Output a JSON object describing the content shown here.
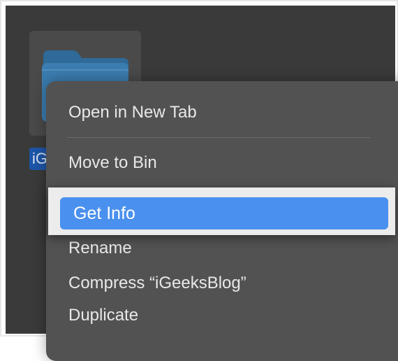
{
  "desktop": {
    "folder_icon": "folder-icon",
    "folder_name_visible": "iG"
  },
  "context_menu": {
    "items": [
      {
        "label": "Open in New Tab"
      },
      {
        "label": "Move to Bin"
      },
      {
        "label": "Get Info",
        "highlighted": true
      },
      {
        "label": "Rename"
      },
      {
        "label": "Compress “iGeeksBlog”"
      },
      {
        "label": "Duplicate"
      }
    ]
  },
  "colors": {
    "highlight": "#4a90ee",
    "menu_background": "#525252",
    "folder": "#3b7db0"
  }
}
